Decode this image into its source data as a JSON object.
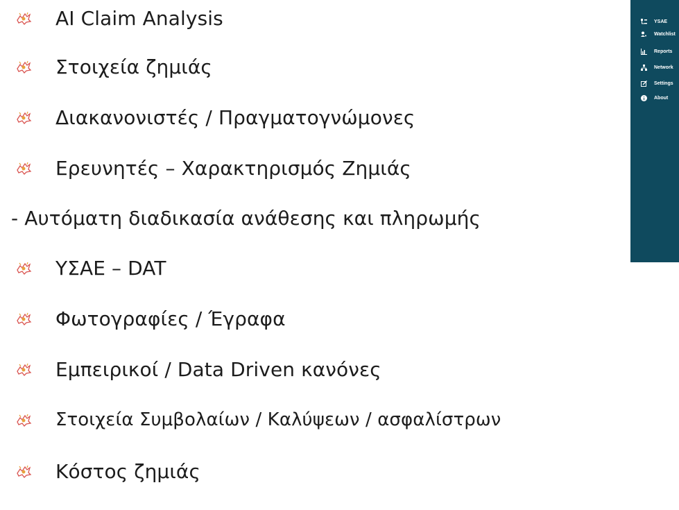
{
  "bullet_items": [
    {
      "text": "AI Claim Analysis",
      "bullet": "dragon-icon"
    },
    {
      "text": "Στοιχεία ζημιάς",
      "bullet": "dragon-icon"
    },
    {
      "text": "Διακανονιστές / Πραγματογνώμονες",
      "bullet": "dragon-icon"
    },
    {
      "text": "Ερευνητές – Χαρακτηρισμός Ζημιάς",
      "bullet": "dragon-icon"
    },
    {
      "text": "- Αυτόματη διαδικασία ανάθεσης και πληρωμής",
      "bullet": "none"
    },
    {
      "text": "ΥΣΑΕ – DAT",
      "bullet": "dragon-icon"
    },
    {
      "text": "Φωτογραφίες / Έγραφα",
      "bullet": "dragon-icon"
    },
    {
      "text": "Εμπειρικοί / Data Driven κανόνες",
      "bullet": "dragon-icon"
    },
    {
      "text": "Στοιχεία  Συμβολαίων / Καλύψεων / ασφαλίστρων",
      "bullet": "dragon-icon"
    },
    {
      "text": "Κόστος ζημιάς",
      "bullet": "dragon-icon"
    }
  ],
  "sidebar": {
    "background": "#0f4a5e",
    "items": [
      {
        "label": "YSAE",
        "icon": "hierarchy-icon"
      },
      {
        "label": "Watchlist",
        "icon": "users-icon"
      },
      {
        "label": "Reports",
        "icon": "chart-icon"
      },
      {
        "label": "Network",
        "icon": "network-icon"
      },
      {
        "label": "Settings",
        "icon": "edit-icon"
      },
      {
        "label": "About",
        "icon": "info-icon"
      }
    ]
  },
  "colors": {
    "text": "#1c1c1c",
    "bullet_red": "#d9534f",
    "bullet_orange": "#e8a33d"
  }
}
